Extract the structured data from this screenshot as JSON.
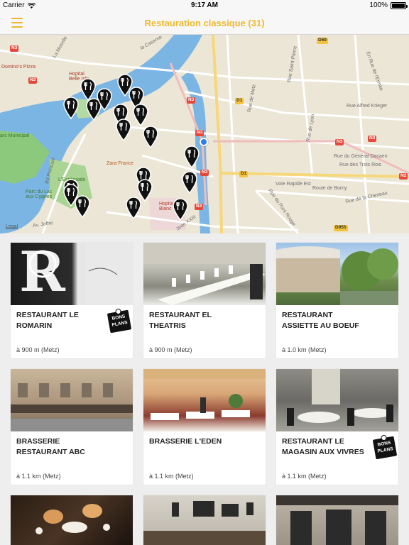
{
  "status_bar": {
    "carrier": "Carrier",
    "time": "9:17 AM",
    "battery": "100%"
  },
  "nav": {
    "title": "Restauration classique (31)",
    "menu_icon": "hamburger-icon",
    "accent": "#f0b92a"
  },
  "map": {
    "legal": "Legal",
    "labels": {
      "dominos": "Domino's Pizza",
      "hopital_belle": "Hopital\nBelle Isle",
      "parc_municipal": "arc Municipal",
      "esplanade": "L'Esplanade",
      "parc_lac": "Parc du Lac\naux Cygnes",
      "zara": "Zara France",
      "hopital_blanc": "Hopital\nBlanc",
      "caserne": "la Caserne",
      "moselle": "La Moselle",
      "poincare": "Bd Poincaré",
      "joffre": "Av. Joffre",
      "jean_xxiii": "Jean XXIII",
      "voie_rapide": "Voie Rapide Est",
      "route_borny": "Route de Borny",
      "pont_rouge": "Rue du Pont Rouge",
      "general_dacaen": "Rue du Général Dacaen",
      "trois_rois": "Rue des Trois Rois",
      "alfred_krieger": "Rue Alfred Krieger",
      "de_lyon": "Rue de Lyon",
      "cheneau": "Rue de la Cheneau",
      "st_pierre": "Rue Saint-Pierre",
      "de_metz": "Rue de Metz",
      "ermite": "En Rue de l'Ermite"
    },
    "roads": [
      "N3",
      "N3",
      "N3",
      "N3",
      "N3",
      "N3",
      "N3",
      "N3",
      "D1",
      "D1",
      "D69",
      "D955",
      "N2"
    ]
  },
  "restaurants": [
    {
      "name": "RESTAURANT LE ROMARIN",
      "distance": "à 900 m  (Metz)",
      "bons_plans": true
    },
    {
      "name": "RESTAURANT EL THEATRIS",
      "distance": "à 900 m  (Metz)",
      "bons_plans": false
    },
    {
      "name": "RESTAURANT ASSIETTE AU BOEUF",
      "distance": "à 1.0 km  (Metz)",
      "bons_plans": false
    },
    {
      "name": "BRASSERIE RESTAURANT ABC",
      "distance": "à 1.1 km  (Metz)",
      "bons_plans": false
    },
    {
      "name": "BRASSERIE L'EDEN",
      "distance": "à 1.1 km  (Metz)",
      "bons_plans": false
    },
    {
      "name": "RESTAURANT LE MAGASIN AUX VIVRES",
      "distance": "à 1.1 km  (Metz)",
      "bons_plans": true
    },
    {
      "name": "",
      "distance": "",
      "bons_plans": false
    },
    {
      "name": "",
      "distance": "",
      "bons_plans": false
    },
    {
      "name": "",
      "distance": "",
      "bons_plans": false
    }
  ],
  "bons_plans_label": {
    "line1": "BONS",
    "line2": "PLANS"
  }
}
